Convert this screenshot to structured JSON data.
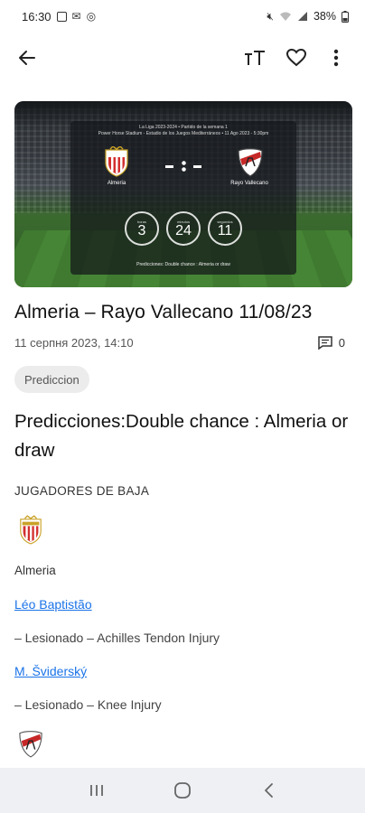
{
  "status_bar": {
    "time": "16:30",
    "battery": "38%",
    "left_icons": [
      "gallery-icon",
      "mail-icon",
      "location-icon"
    ],
    "right_icons": [
      "mute-icon",
      "wifi-icon",
      "signal-icon",
      "battery-icon"
    ]
  },
  "app_bar": {
    "icons": [
      "back-arrow-icon",
      "text-size-icon",
      "heart-icon",
      "more-vert-icon"
    ]
  },
  "hero": {
    "league_line": "La Liga 2023-2024 • Partido de la semana 1",
    "venue_line": "Power Horse Stadium - Estadio de los Juegos Mediterráneos • 11 Ago 2023 - 5:30pm",
    "home_team": "Almeria",
    "away_team": "Rayo Vallecano",
    "stats": [
      {
        "label": "horas",
        "value": "3"
      },
      {
        "label": "minutos",
        "value": "24"
      },
      {
        "label": "segundos",
        "value": "11"
      }
    ],
    "footer": "Predicciones: Double chance : Almeria or draw"
  },
  "article": {
    "title": "Almeria – Rayo Vallecano 11/08/23",
    "date": "11 серпня 2023, 14:10",
    "comment_count": "0",
    "category_chip": "Prediccion",
    "headline": "Predicciones:Double chance : Almeria or draw",
    "section_label": "JUGADORES DE BAJA",
    "club_name": "Almeria",
    "players": [
      {
        "name": "Léo Baptistão",
        "status": "– Lesionado – Achilles Tendon Injury"
      },
      {
        "name": "M. Šviderský",
        "status": "– Lesionado – Knee Injury"
      }
    ]
  },
  "colors": {
    "link": "#1a73e8",
    "chip_bg": "#ececec",
    "nav_bg": "#eef0f4",
    "almeria_red": "#d32f2f",
    "rayo_red": "#c62828"
  },
  "nav_bar": {
    "icons": [
      "recent-apps-icon",
      "home-icon",
      "back-icon"
    ]
  }
}
